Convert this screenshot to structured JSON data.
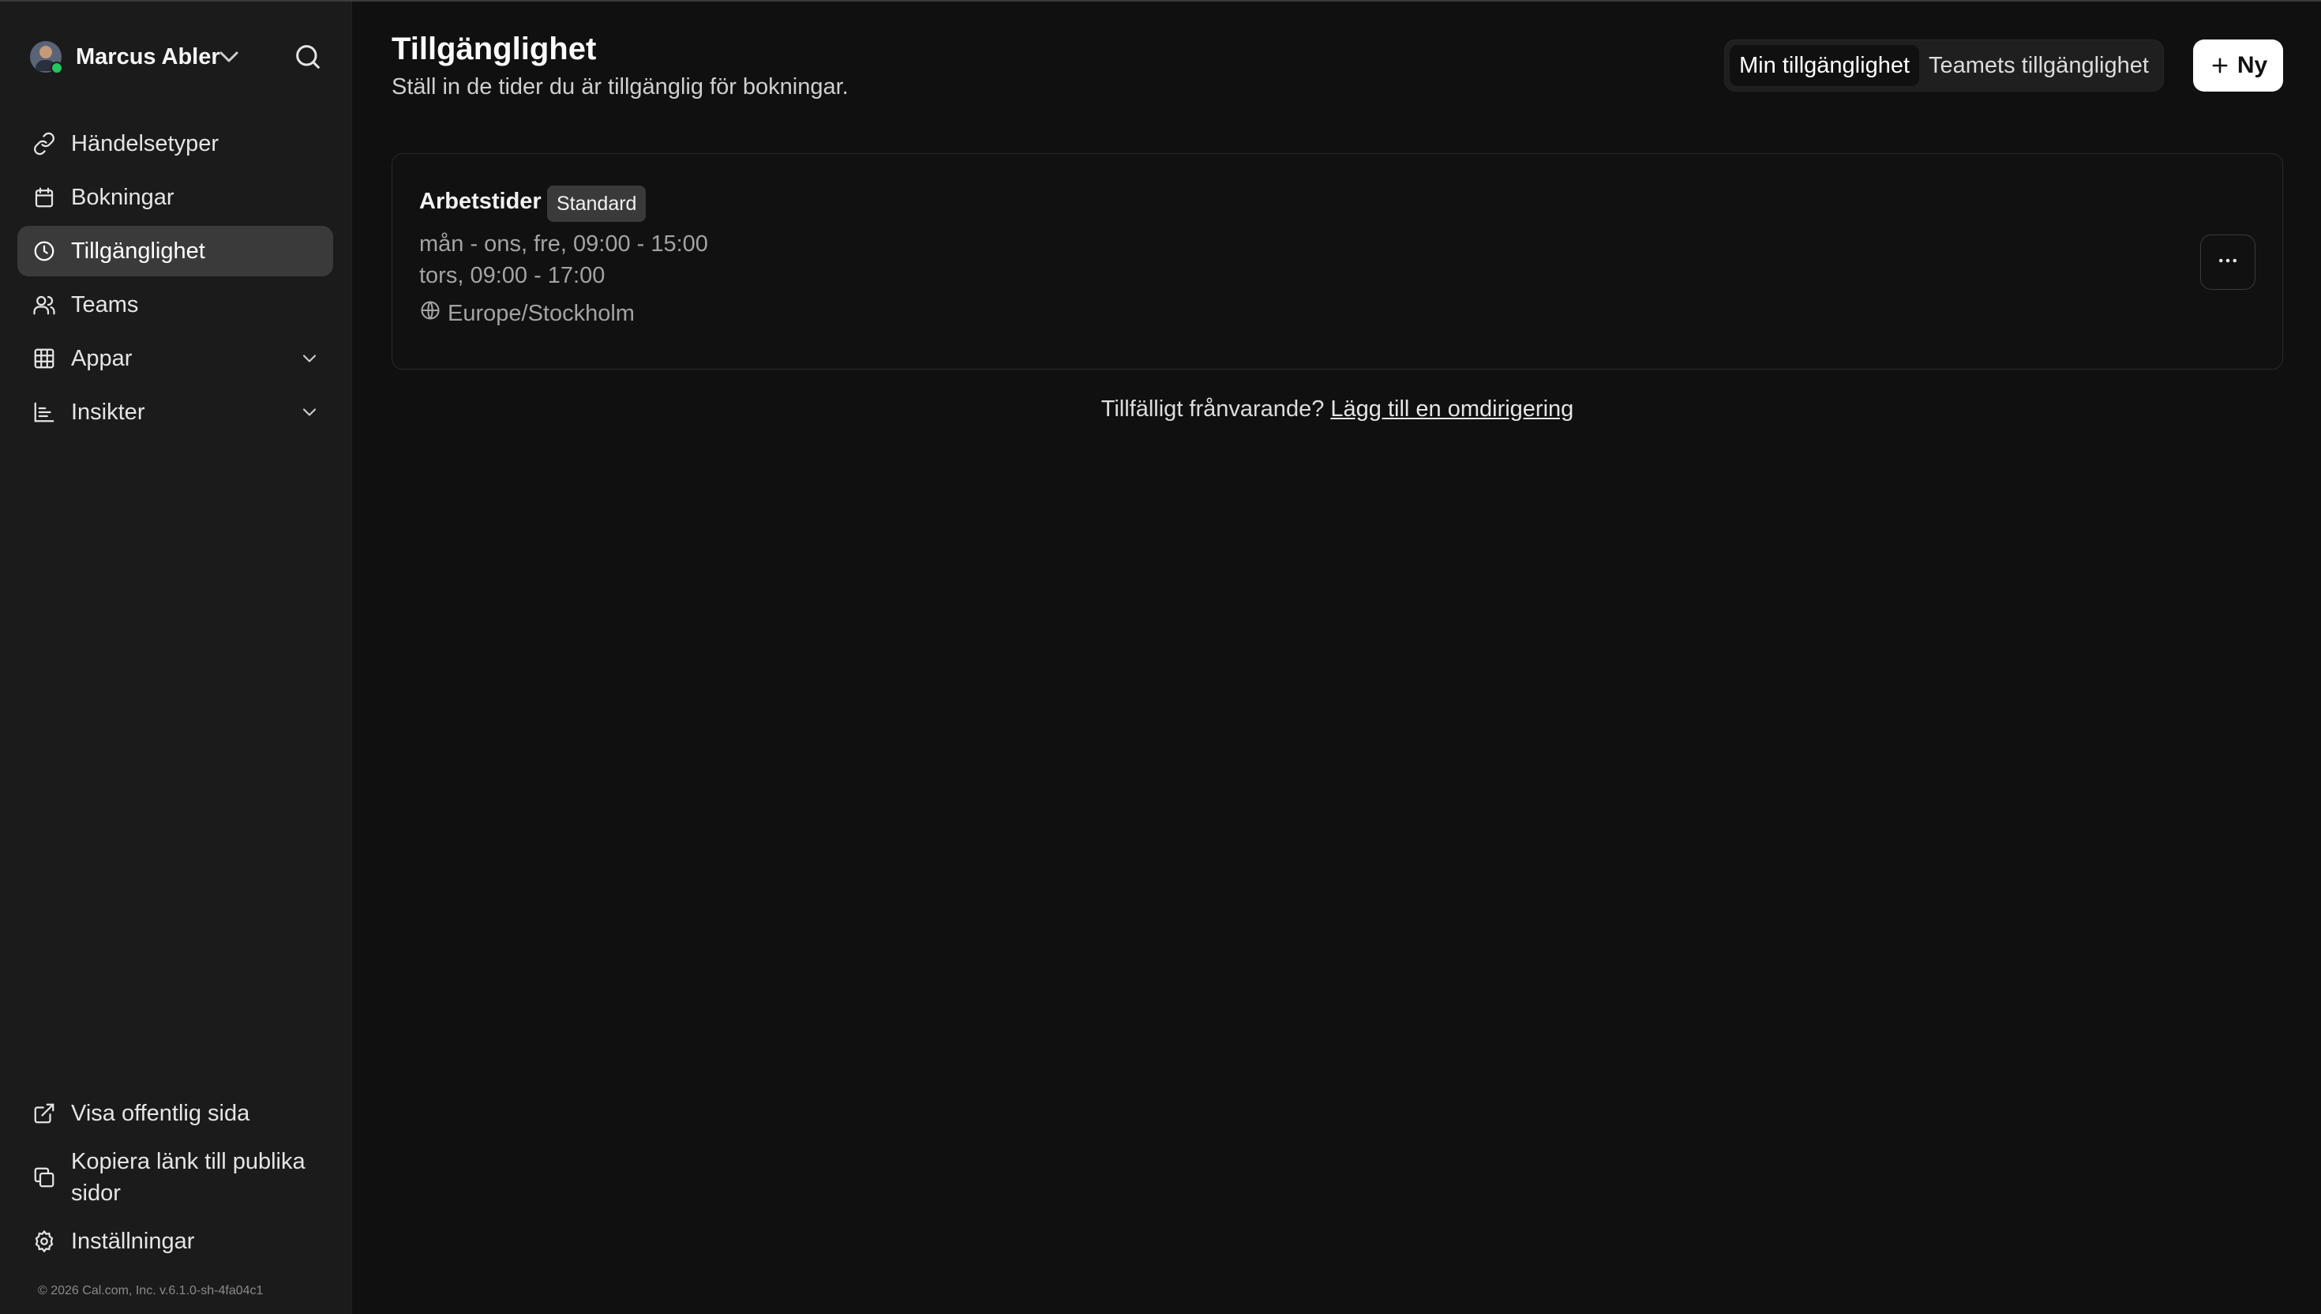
{
  "user": {
    "name": "Marcus Abler"
  },
  "sidebar": {
    "items": [
      {
        "label": "Händelsetyper",
        "icon": "link-icon"
      },
      {
        "label": "Bokningar",
        "icon": "calendar-icon"
      },
      {
        "label": "Tillgänglighet",
        "icon": "clock-icon",
        "active": true
      },
      {
        "label": "Teams",
        "icon": "users-icon"
      },
      {
        "label": "Appar",
        "icon": "grid-icon",
        "expandable": true
      },
      {
        "label": "Insikter",
        "icon": "chart-icon",
        "expandable": true
      }
    ],
    "bottom": [
      {
        "label": "Visa offentlig sida",
        "icon": "external-link-icon"
      },
      {
        "label": "Kopiera länk till publika sidor",
        "icon": "copy-icon"
      },
      {
        "label": "Inställningar",
        "icon": "gear-icon"
      }
    ],
    "footer": "© 2026 Cal.com, Inc. v.6.1.0-sh-4fa04c1"
  },
  "header": {
    "title": "Tillgänglighet",
    "subtitle": "Ställ in de tider du är tillgänglig för bokningar.",
    "toggle": {
      "mine": "Min tillgänglighet",
      "team": "Teamets tillgänglighet",
      "selected": "mine"
    },
    "new_label": "Ny"
  },
  "schedule": {
    "name": "Arbetstider",
    "badge": "Standard",
    "line1": "mån - ons, fre, 09:00 - 15:00",
    "line2": "tors, 09:00 - 17:00",
    "timezone": "Europe/Stockholm"
  },
  "ooo": {
    "text": "Tillfälligt frånvarande?",
    "link": "Lägg till en omdirigering"
  },
  "colors": {
    "background": "#101010",
    "sidebar": "#1b1b1b",
    "active": "#3a3a3a",
    "primary_button": "#ffffff",
    "status_online": "#22c55e"
  }
}
